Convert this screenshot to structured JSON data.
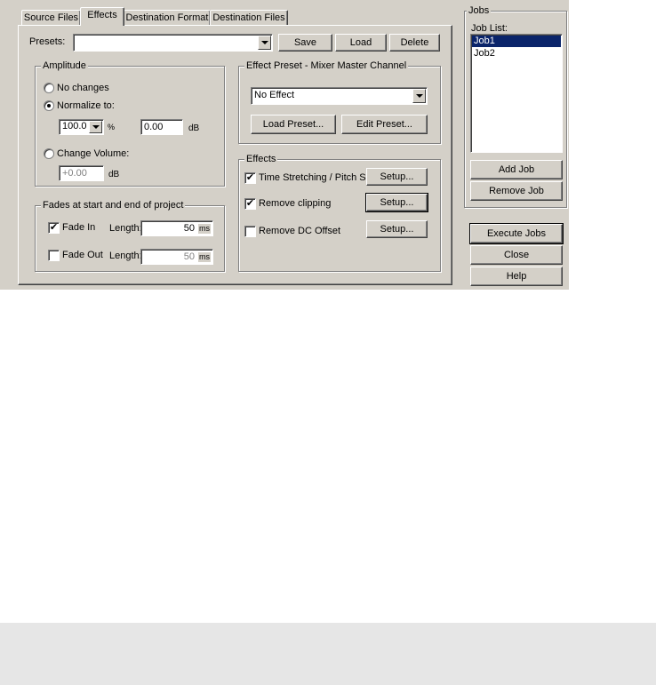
{
  "tabs": [
    "Source Files",
    "Effects",
    "Destination Format",
    "Destination Files"
  ],
  "active_tab": "Effects",
  "presets": {
    "label": "Presets:",
    "value": "",
    "save": "Save",
    "load": "Load",
    "delete": "Delete"
  },
  "amplitude": {
    "title": "Amplitude",
    "no_changes": "No changes",
    "normalize_to": "Normalize to:",
    "normalize_value": "100.0",
    "percent_sign": "%",
    "db_value": "0.00",
    "db_unit": "dB",
    "change_volume": "Change Volume:",
    "volume_value": "+0.00",
    "volume_unit": "dB",
    "selected": "normalize"
  },
  "fades": {
    "title": "Fades at start and end of project",
    "fade_in": "Fade In",
    "fade_in_checked": true,
    "fade_in_length_label": "Length:",
    "fade_in_length": "50",
    "fade_out": "Fade Out",
    "fade_out_checked": false,
    "fade_out_length_label": "Length:",
    "fade_out_length": "50",
    "unit": "ms"
  },
  "effect_preset": {
    "title": "Effect Preset - Mixer Master Channel",
    "value": "No Effect",
    "load_preset": "Load Preset...",
    "edit_preset": "Edit Preset..."
  },
  "effects": {
    "title": "Effects",
    "items": [
      {
        "label": "Time Stretching / Pitch Sh.",
        "checked": true,
        "setup": "Setup..."
      },
      {
        "label": "Remove clipping",
        "checked": true,
        "setup": "Setup..."
      },
      {
        "label": "Remove DC Offset",
        "checked": false,
        "setup": "Setup..."
      }
    ]
  },
  "jobs": {
    "title": "Jobs",
    "list_label": "Job List:",
    "items": [
      "Job1",
      "Job2"
    ],
    "selected": "Job1",
    "add_job": "Add Job",
    "remove_job": "Remove Job"
  },
  "actions": {
    "execute": "Execute Jobs",
    "close": "Close",
    "help": "Help"
  },
  "icons": {
    "check": "✔"
  },
  "colors": {
    "face": "#d4d0c8",
    "selection": "#0a246a",
    "footer": "#e6e6e6"
  }
}
